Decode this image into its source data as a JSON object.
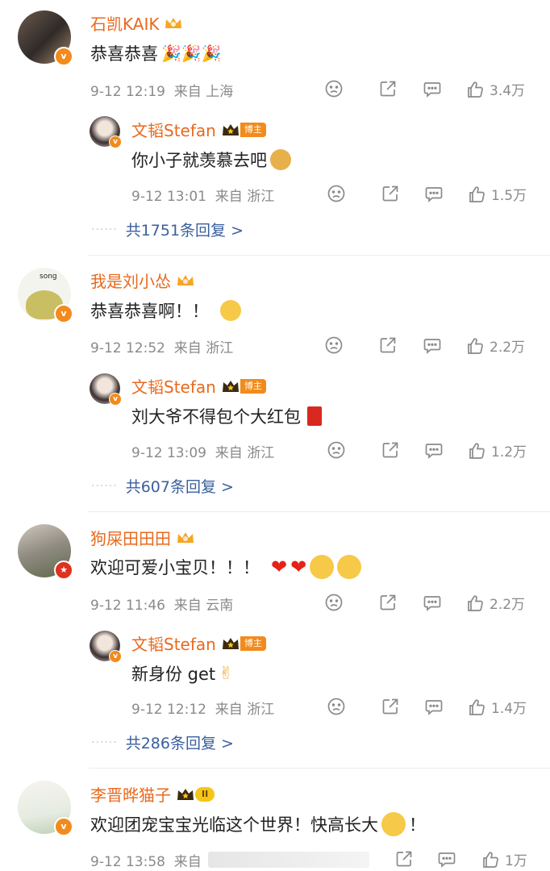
{
  "comments": [
    {
      "user": "石凯KAIK",
      "text": "恭喜恭喜",
      "emoji": "party-popper x3",
      "date": "9-12 12:19",
      "location": "来自 上海",
      "likes": "3.4万",
      "reply": {
        "user": "文韬Stefan",
        "tag": "博主",
        "text": "你小子就羡慕去吧",
        "emoji": "doge",
        "date": "9-12 13:01",
        "location": "来自 浙江",
        "likes": "1.5万"
      },
      "more": "共1751条回复 >"
    },
    {
      "user": "我是刘小怂",
      "text": "恭喜恭喜啊！！",
      "emoji": "tears-of-joy",
      "date": "9-12 12:52",
      "location": "来自 浙江",
      "likes": "2.2万",
      "reply": {
        "user": "文韬Stefan",
        "tag": "博主",
        "text": "刘大爷不得包个大红包",
        "emoji": "red-envelope",
        "date": "9-12 13:09",
        "location": "来自 浙江",
        "likes": "1.2万"
      },
      "more": "共607条回复 >"
    },
    {
      "user": "狗屎田田田",
      "text": "欢迎可爱小宝贝！！！",
      "emoji": "hearts-and-smiles",
      "date": "9-12 11:46",
      "location": "来自 云南",
      "likes": "2.2万",
      "reply": {
        "user": "文韬Stefan",
        "tag": "博主",
        "text": "新身份 get",
        "emoji": "victory-hand",
        "date": "9-12 12:12",
        "location": "来自 浙江",
        "likes": "1.4万"
      },
      "more": "共286条回复 >"
    },
    {
      "user": "李晋晔猫子",
      "level": "II",
      "text": "欢迎团宠宝宝光临这个世界！快高长大",
      "text_end": "！",
      "emoji": "smile-flower",
      "date": "9-12 13:58",
      "location": "来自",
      "likes": "1万"
    }
  ],
  "colors": {
    "name": "#e8691d",
    "link": "#3a5f9c",
    "meta": "#8a8a8a",
    "badge": "#f28b1c"
  }
}
